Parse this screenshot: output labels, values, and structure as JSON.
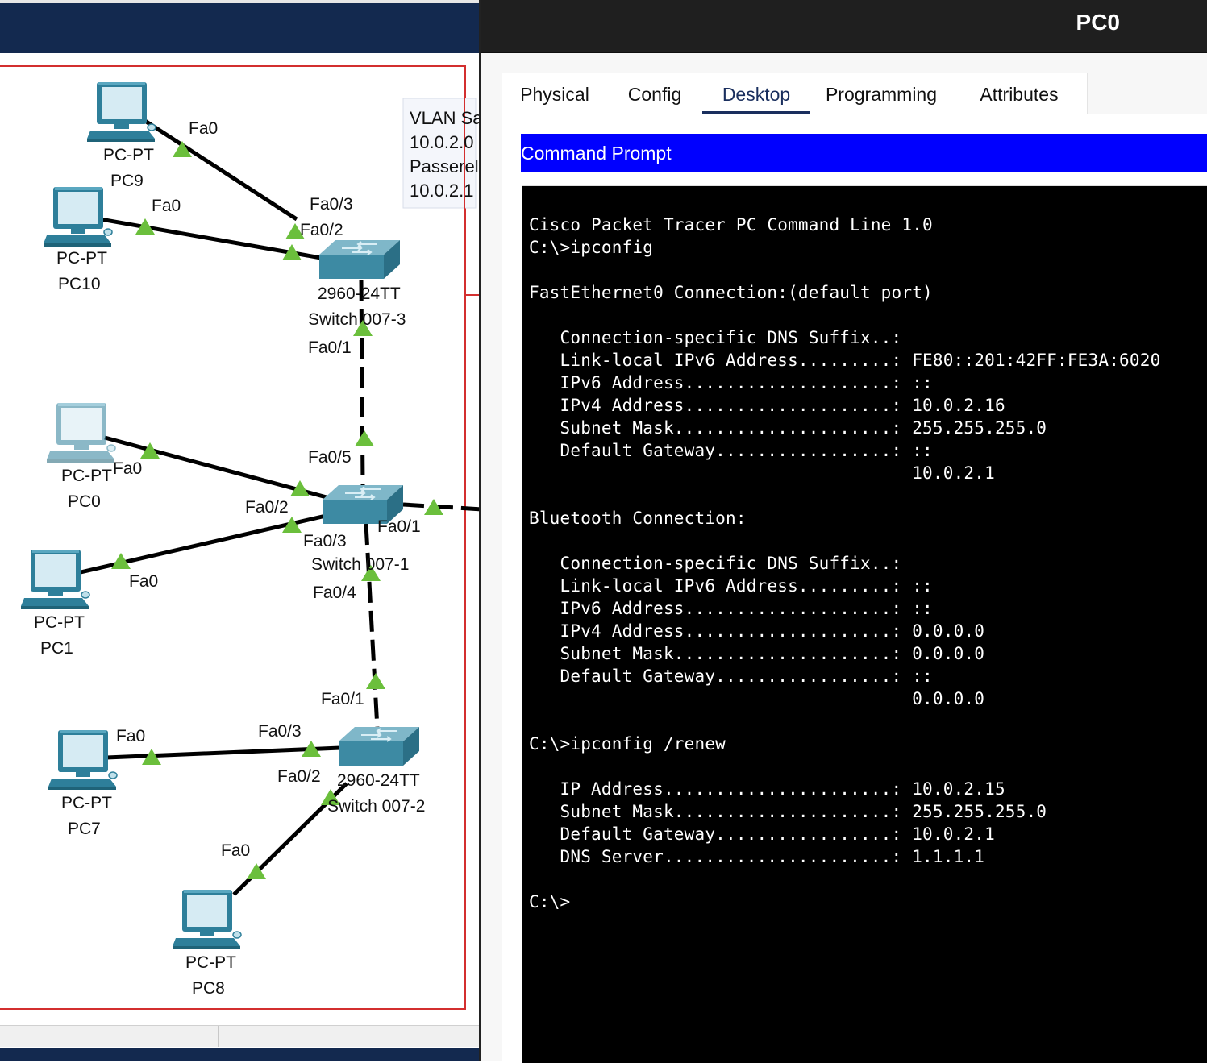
{
  "workspace": {
    "note": {
      "line1": "VLAN Sa",
      "line2": "10.0.2.0",
      "line3": "Passerel",
      "line4": "10.0.2.1"
    },
    "devices": {
      "pc9": {
        "model": "PC-PT",
        "name": "PC9"
      },
      "pc10": {
        "model": "PC-PT",
        "name": "PC10"
      },
      "pc0": {
        "model": "PC-PT",
        "name": "PC0"
      },
      "pc1": {
        "model": "PC-PT",
        "name": "PC1"
      },
      "pc7": {
        "model": "PC-PT",
        "name": "PC7"
      },
      "pc8": {
        "model": "PC-PT",
        "name": "PC8"
      },
      "sw3": {
        "model": "2960-24TT",
        "name": "Switch 007-3"
      },
      "sw1": {
        "model": "2960-24TT",
        "name": "Switch 007-1"
      },
      "sw2": {
        "model": "2960-24TT",
        "name": "Switch 007-2"
      }
    },
    "ports": {
      "pc9_fa0": "Fa0",
      "pc10_fa0": "Fa0",
      "sw3_fa03": "Fa0/3",
      "sw3_fa02": "Fa0/2",
      "sw3_fa01": "Fa0/1",
      "sw1_fa05": "Fa0/5",
      "pc0_fa0": "Fa0",
      "sw1_fa02": "Fa0/2",
      "sw1_fa03": "Fa0/3",
      "sw1_fa01": "Fa0/1",
      "pc1_fa0": "Fa0",
      "sw1_fa04": "Fa0/4",
      "sw2_fa01": "Fa0/1",
      "pc7_fa0": "Fa0",
      "sw2_fa03": "Fa0/3",
      "sw2_fa02": "Fa0/2",
      "pc8_fa0": "Fa0"
    },
    "colors": {
      "link_up": "#6bbf3c",
      "area_border": "#d32f2f",
      "topbar": "#13294f"
    }
  },
  "window": {
    "title": "PC0",
    "tabs": {
      "physical": "Physical",
      "config": "Config",
      "desktop": "Desktop",
      "programming": "Programming",
      "attributes": "Attributes"
    },
    "active_tab": "Desktop",
    "app_header": "Command Prompt",
    "terminal": {
      "output": "Cisco Packet Tracer PC Command Line 1.0\nC:\\>ipconfig\n\nFastEthernet0 Connection:(default port)\n\n   Connection-specific DNS Suffix..:\n   Link-local IPv6 Address.........: FE80::201:42FF:FE3A:6020\n   IPv6 Address....................: ::\n   IPv4 Address....................: 10.0.2.16\n   Subnet Mask.....................: 255.255.255.0\n   Default Gateway.................: ::\n                                     10.0.2.1\n\nBluetooth Connection:\n\n   Connection-specific DNS Suffix..:\n   Link-local IPv6 Address.........: ::\n   IPv6 Address....................: ::\n   IPv4 Address....................: 0.0.0.0\n   Subnet Mask.....................: 0.0.0.0\n   Default Gateway.................: ::\n                                     0.0.0.0\n\nC:\\>ipconfig /renew\n\n   IP Address......................: 10.0.2.15\n   Subnet Mask.....................: 255.255.255.0\n   Default Gateway.................: 10.0.2.1\n   DNS Server......................: 1.1.1.1\n\nC:\\>"
    },
    "colors": {
      "header_blue": "#0000ff",
      "active_tab": "#1a2f5e",
      "terminal_bg": "#000000"
    }
  }
}
